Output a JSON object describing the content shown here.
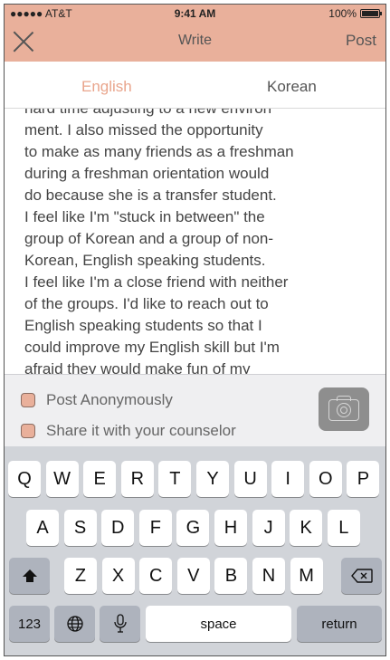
{
  "status_bar": {
    "carrier": "●●●●● AT&T",
    "time": "9:41 AM",
    "battery": "100%",
    "battery_level": 1.0
  },
  "nav": {
    "title": "Write",
    "post_label": "Post"
  },
  "tabs": {
    "english": "English",
    "korean": "Korean"
  },
  "editor": {
    "text": "hard time adjusting to a new environ\nment. I also missed the opportunity\nto make as many friends as a freshman\nduring a freshman orientation would\ndo because she is a transfer student.\nI feel like I'm \"stuck in between\" the\ngroup of Korean and a group of non-\nKorean, English speaking students.\nI feel like I'm a close friend with neither\nof the groups. I'd like to reach out to\nEnglish speaking students so that I\ncould improve my English skill but I'm\nafraid they would make fun of my\naccent."
  },
  "options": {
    "anonymous": "Post Anonymously",
    "counselor": "Share it with your counselor"
  },
  "keyboard": {
    "row1": [
      "Q",
      "W",
      "E",
      "R",
      "T",
      "Y",
      "U",
      "I",
      "O",
      "P"
    ],
    "row2": [
      "A",
      "S",
      "D",
      "F",
      "G",
      "H",
      "J",
      "K",
      "L"
    ],
    "row3": [
      "Z",
      "X",
      "C",
      "V",
      "B",
      "N",
      "M"
    ],
    "numbers": "123",
    "space": "space",
    "return": "return"
  },
  "colors": {
    "accent": "#e9b09b",
    "tab_active": "#e9a58c",
    "keyboard_bg": "#d1d4d9"
  }
}
